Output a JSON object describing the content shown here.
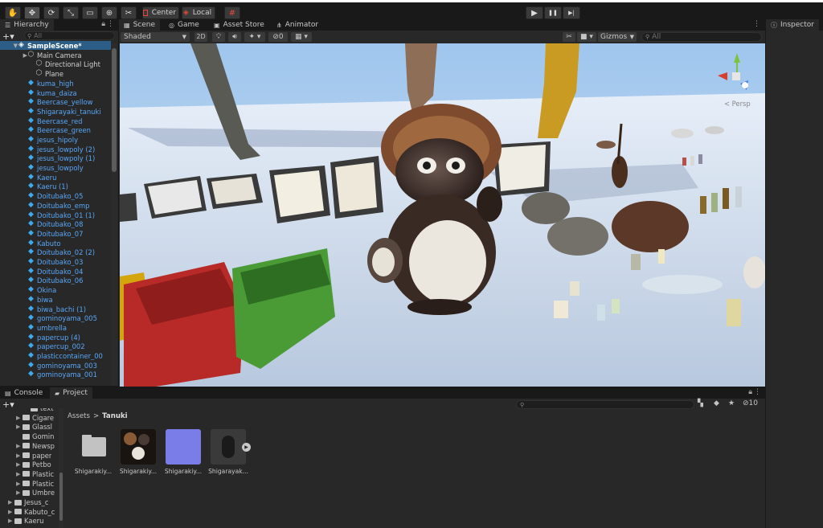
{
  "toolbar": {
    "tools": [
      "hand-tool",
      "move-tool",
      "rotate-tool",
      "scale-tool",
      "rect-tool",
      "transform-tool",
      "custom-tool"
    ],
    "pivot_label": "Center",
    "space_label": "Local",
    "play_icon": "▶",
    "pause_icon": "❚❚",
    "step_icon": "▶|"
  },
  "hierarchy": {
    "tab_label": "Hierarchy",
    "search_placeholder": "All",
    "scene_name": "SampleScene*",
    "children": [
      "Main Camera",
      "Directional Light",
      "Plane"
    ],
    "prefabs": [
      "kuma_high",
      "kuma_daiza",
      "Beercase_yellow",
      "Shigarayaki_tanuki",
      "Beercase_red",
      "Beercase_green",
      "jesus_hipoly",
      "jesus_lowpoly (2)",
      "jesus_lowpoly (1)",
      "jesus_lowpoly",
      "Kaeru",
      "Kaeru (1)",
      "Doitubako_05",
      "Doitubako_emp",
      "Doitubako_01 (1)",
      "Doitubako_08",
      "Doitubako_07",
      "Kabuto",
      "Doitubako_02 (2)",
      "Doitubako_03",
      "Doitubako_04",
      "Doitubako_06",
      "Okina",
      "biwa",
      "biwa_bachi (1)",
      "gominoyama_005",
      "umbrella",
      "papercup (4)",
      "papercup_002",
      "plasticcontainer_00",
      "gominoyama_003",
      "gominoyama_001"
    ]
  },
  "scene_tabs": {
    "scene": "Scene",
    "game": "Game",
    "asset_store": "Asset Store",
    "animator": "Animator"
  },
  "scene_toolbar": {
    "shading": "Shaded",
    "mode_2d": "2D",
    "hidden_count": "0",
    "gizmos": "Gizmos",
    "search_placeholder": "All",
    "persp": "< Persp"
  },
  "inspector": {
    "tab_label": "Inspector"
  },
  "bottom_tabs": {
    "console": "Console",
    "project": "Project"
  },
  "project": {
    "breadcrumb_root": "Assets",
    "breadcrumb_sep": ">",
    "breadcrumb_current": "Tanuki",
    "hidden_count": "10",
    "tree": [
      {
        "label": "text",
        "indent": 3,
        "arrow": false
      },
      {
        "label": "Cigare",
        "indent": 2,
        "arrow": true
      },
      {
        "label": "Glassl",
        "indent": 2,
        "arrow": true
      },
      {
        "label": "Gomin",
        "indent": 2,
        "arrow": false
      },
      {
        "label": "Newsp",
        "indent": 2,
        "arrow": true
      },
      {
        "label": "paper",
        "indent": 2,
        "arrow": true
      },
      {
        "label": "Petbo",
        "indent": 2,
        "arrow": true
      },
      {
        "label": "Plastic",
        "indent": 2,
        "arrow": true
      },
      {
        "label": "Plastic",
        "indent": 2,
        "arrow": true
      },
      {
        "label": "Umbre",
        "indent": 2,
        "arrow": true
      },
      {
        "label": "Jesus_c",
        "indent": 1,
        "arrow": true
      },
      {
        "label": "Kabuto_c",
        "indent": 1,
        "arrow": true
      },
      {
        "label": "Kaeru",
        "indent": 1,
        "arrow": true
      }
    ],
    "assets": [
      {
        "label": "Shigarakiy...",
        "kind": "folder"
      },
      {
        "label": "Shigarakiy...",
        "kind": "texture"
      },
      {
        "label": "Shigarakiy...",
        "kind": "normal"
      },
      {
        "label": "Shigarayak...",
        "kind": "model"
      }
    ]
  }
}
